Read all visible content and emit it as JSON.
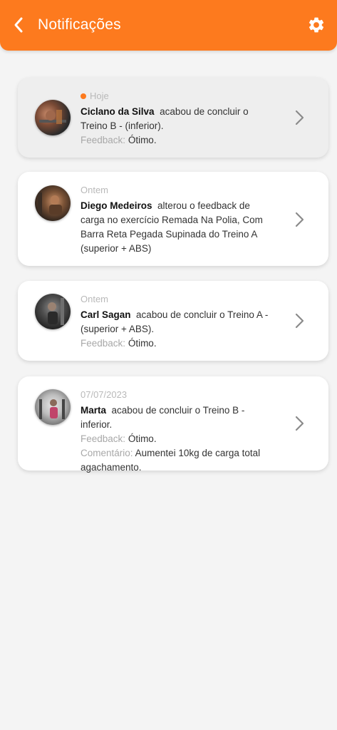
{
  "header": {
    "title": "Notificações",
    "back_icon": "chevron-left-icon",
    "settings_icon": "gear-icon",
    "background": "#fd7a1e"
  },
  "labels": {
    "feedback": "Feedback:",
    "comment": "Comentário:"
  },
  "notifications": [
    {
      "date": "Hoje",
      "unread": true,
      "name": "Ciclano da Silva",
      "text": "acabou de concluir o Treino B - (inferior).",
      "feedback": "Ótimo."
    },
    {
      "date": "Ontem",
      "unread": false,
      "name": "Diego Medeiros",
      "text": "alterou o feedback de carga no exercício Remada Na Polia, Com Barra Reta Pegada Supinada do Treino A (superior +  ABS)"
    },
    {
      "date": "Ontem",
      "unread": false,
      "name": "Carl Sagan",
      "text": "acabou de concluir o Treino A - (superior + ABS).",
      "feedback": "Ótimo."
    },
    {
      "date": "07/07/2023",
      "unread": false,
      "name": "Marta",
      "text": "acabou de concluir o Treino B - inferior.",
      "feedback": "Ótimo.",
      "comment": "Aumentei 10kg de carga total agachamento."
    }
  ],
  "colors": {
    "accent": "#fd7a1e",
    "background": "#f4f4f4",
    "unread_card": "#eeeeee"
  }
}
